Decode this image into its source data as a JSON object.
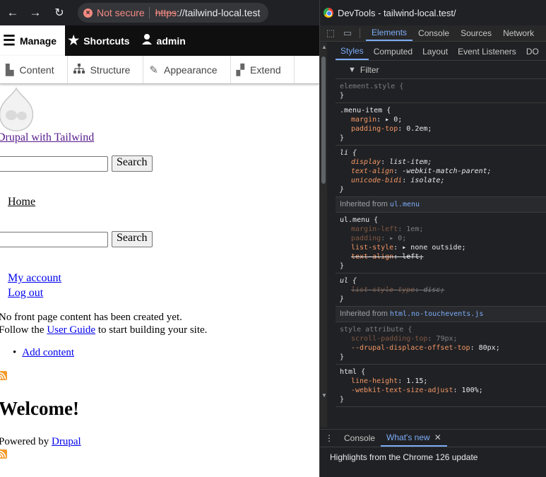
{
  "browser": {
    "back_icon": "arrow-left-icon",
    "forward_icon": "arrow-right-icon",
    "reload_icon": "reload-icon",
    "security_label": "Not secure",
    "url_scheme": "https",
    "url_host": "://tailwind-local.test"
  },
  "toolbar": {
    "manage": "Manage",
    "shortcuts": "Shortcuts",
    "user": "admin",
    "tray": [
      "Content",
      "Structure",
      "Appearance",
      "Extend"
    ]
  },
  "page": {
    "site_name": "Drupal with Tailwind",
    "search_button": "Search",
    "search_button_2": "Search",
    "home": "Home",
    "my_account": "My account",
    "log_out": "Log out",
    "empty_1": "No front page content has been created yet.",
    "follow_prefix": "Follow the ",
    "user_guide": "User Guide",
    "follow_suffix": " to start building your site.",
    "add_content": "Add content",
    "welcome": "Welcome!",
    "powered_by": "Powered by ",
    "drupal": "Drupal"
  },
  "devtools": {
    "title": "DevTools - tailwind-local.test/",
    "tabs": [
      "Elements",
      "Console",
      "Sources",
      "Network"
    ],
    "sub_tabs": [
      "Styles",
      "Computed",
      "Layout",
      "Event Listeners",
      "DO"
    ],
    "filter_placeholder": "Filter",
    "inherited_label": "Inherited from ",
    "inherited_1": "ul.menu",
    "inherited_2": "html.no-touchevents.js",
    "drawer_tabs": [
      "Console",
      "What's new"
    ],
    "highlights": "Highlights from the Chrome 126 update"
  }
}
